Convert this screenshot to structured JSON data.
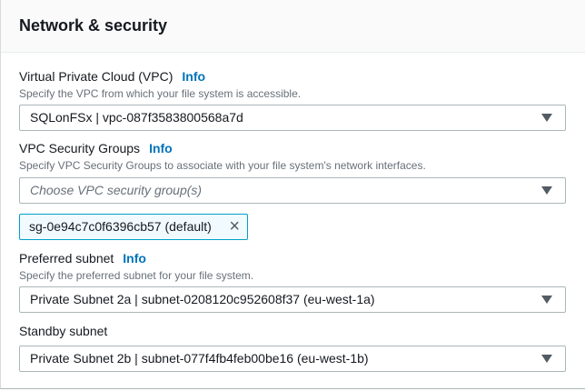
{
  "section_title": "Network & security",
  "vpc": {
    "label": "Virtual Private Cloud (VPC)",
    "info": "Info",
    "description": "Specify the VPC from which your file system is accessible.",
    "value": "SQLonFSx | vpc-087f3583800568a7d"
  },
  "security_groups": {
    "label": "VPC Security Groups",
    "info": "Info",
    "description": "Specify VPC Security Groups to associate with your file system's network interfaces.",
    "placeholder": "Choose VPC security group(s)",
    "tokens": [
      {
        "label": "sg-0e94c7c0f6396cb57 (default)",
        "remove_icon": "×"
      }
    ]
  },
  "preferred_subnet": {
    "label": "Preferred subnet",
    "info": "Info",
    "description": "Specify the preferred subnet for your file system.",
    "value": "Private Subnet 2a | subnet-0208120c952608f37 (eu-west-1a)"
  },
  "standby_subnet": {
    "label": "Standby subnet",
    "value": "Private Subnet 2b | subnet-077f4fb4feb00be16 (eu-west-1b)"
  }
}
